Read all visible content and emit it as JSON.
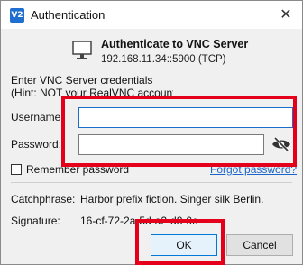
{
  "window": {
    "title": "Authentication",
    "app_icon_text": "V2",
    "close_glyph": "✕"
  },
  "header": {
    "title": "Authenticate to VNC Server",
    "server": "192.168.11.34::5900 (TCP)"
  },
  "credentials": {
    "line1": "Enter VNC Server credentials",
    "line2": "(Hint: NOT your RealVNC account details)"
  },
  "form": {
    "username_label": "Username:",
    "username_value": "",
    "password_label": "Password:",
    "password_value": "",
    "remember_label": "Remember password",
    "remember_checked": false,
    "forgot_link": "Forgot password?"
  },
  "info": {
    "catchphrase_label": "Catchphrase:",
    "catchphrase_value": "Harbor prefix fiction. Singer silk Berlin.",
    "signature_label": "Signature:",
    "signature_value": "16-cf-72-2a-5d-a2-d8-0c"
  },
  "buttons": {
    "ok": "OK",
    "cancel": "Cancel"
  },
  "colors": {
    "highlight": "#e4001b",
    "link": "#1a66c8",
    "focus": "#1c6dc9"
  },
  "icons": {
    "monitor": "monitor-icon",
    "eye": "eye-slash-icon",
    "close": "close-icon"
  }
}
